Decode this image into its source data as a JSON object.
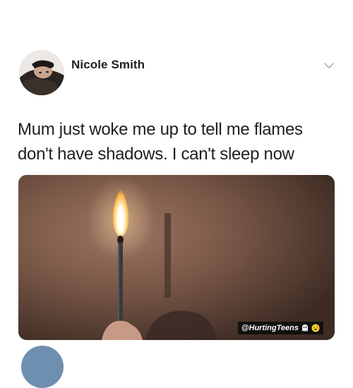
{
  "tweet": {
    "author_name": "Nicole Smith",
    "text_lines": [
      "Mum just woke me up to tell me flames",
      "don't have shadows. I can't sleep now"
    ],
    "media": {
      "watermark": "@HurtingTeens"
    },
    "icons": {
      "menu": "chevron-down-icon",
      "watermark_emojis": [
        "ghost-emoji-icon",
        "laughing-emoji-icon"
      ]
    },
    "colors": {
      "text": "#1f1f1f",
      "chevron": "#b0b4b8",
      "wall": "#7a5a48",
      "flame": "#ffd27a"
    }
  }
}
